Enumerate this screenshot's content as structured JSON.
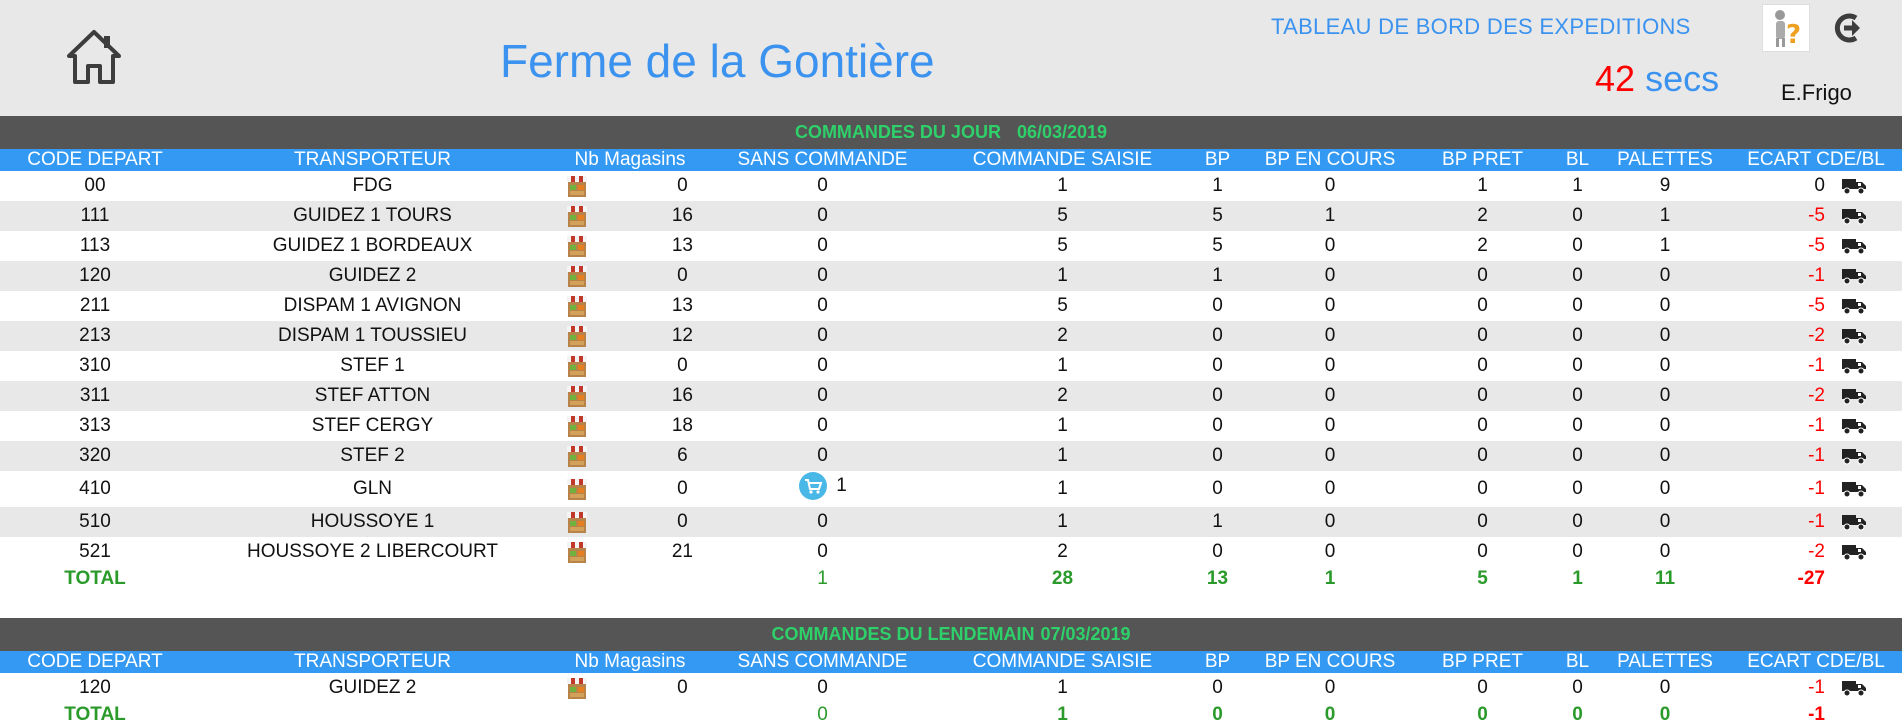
{
  "header": {
    "farm_title": "Ferme de la Gontière",
    "dashboard_title": "TABLEAU DE BORD DES EXPEDITIONS",
    "timer_value": "42",
    "timer_unit": "secs",
    "user": "E.Frigo"
  },
  "columns": [
    "CODE DEPART",
    "TRANSPORTEUR",
    "Nb Magasins",
    "SANS COMMANDE",
    "COMMANDE SAISIE",
    "BP",
    "BP EN COURS",
    "BP PRET",
    "BL",
    "PALETTES",
    "ECART CDE/BL"
  ],
  "section_today": {
    "title": "COMMANDES DU JOUR",
    "date": "06/03/2019",
    "rows": [
      {
        "code": "00",
        "transporteur": "FDG",
        "nb": "0",
        "sans": "0",
        "saisie": "1",
        "bp": "1",
        "encours": "0",
        "pret": "1",
        "bl": "1",
        "palettes": "9",
        "ecart": "0"
      },
      {
        "code": "111",
        "transporteur": "GUIDEZ 1 TOURS",
        "nb": "16",
        "sans": "0",
        "saisie": "5",
        "bp": "5",
        "encours": "1",
        "pret": "2",
        "bl": "0",
        "palettes": "1",
        "ecart": "-5"
      },
      {
        "code": "113",
        "transporteur": "GUIDEZ 1 BORDEAUX",
        "nb": "13",
        "sans": "0",
        "saisie": "5",
        "bp": "5",
        "encours": "0",
        "pret": "2",
        "bl": "0",
        "palettes": "1",
        "ecart": "-5"
      },
      {
        "code": "120",
        "transporteur": "GUIDEZ 2",
        "nb": "0",
        "sans": "0",
        "saisie": "1",
        "bp": "1",
        "encours": "0",
        "pret": "0",
        "bl": "0",
        "palettes": "0",
        "ecart": "-1"
      },
      {
        "code": "211",
        "transporteur": "DISPAM 1 AVIGNON",
        "nb": "13",
        "sans": "0",
        "saisie": "5",
        "bp": "0",
        "encours": "0",
        "pret": "0",
        "bl": "0",
        "palettes": "0",
        "ecart": "-5"
      },
      {
        "code": "213",
        "transporteur": "DISPAM 1 TOUSSIEU",
        "nb": "12",
        "sans": "0",
        "saisie": "2",
        "bp": "0",
        "encours": "0",
        "pret": "0",
        "bl": "0",
        "palettes": "0",
        "ecart": "-2"
      },
      {
        "code": "310",
        "transporteur": "STEF 1",
        "nb": "0",
        "sans": "0",
        "saisie": "1",
        "bp": "0",
        "encours": "0",
        "pret": "0",
        "bl": "0",
        "palettes": "0",
        "ecart": "-1"
      },
      {
        "code": "311",
        "transporteur": "STEF ATTON",
        "nb": "16",
        "sans": "0",
        "saisie": "2",
        "bp": "0",
        "encours": "0",
        "pret": "0",
        "bl": "0",
        "palettes": "0",
        "ecart": "-2"
      },
      {
        "code": "313",
        "transporteur": "STEF CERGY",
        "nb": "18",
        "sans": "0",
        "saisie": "1",
        "bp": "0",
        "encours": "0",
        "pret": "0",
        "bl": "0",
        "palettes": "0",
        "ecart": "-1"
      },
      {
        "code": "320",
        "transporteur": "STEF 2",
        "nb": "6",
        "sans": "0",
        "saisie": "1",
        "bp": "0",
        "encours": "0",
        "pret": "0",
        "bl": "0",
        "palettes": "0",
        "ecart": "-1"
      },
      {
        "code": "410",
        "transporteur": "GLN",
        "nb": "0",
        "sans": "1",
        "saisie": "1",
        "bp": "0",
        "encours": "0",
        "pret": "0",
        "bl": "0",
        "palettes": "0",
        "ecart": "-1"
      },
      {
        "code": "510",
        "transporteur": "HOUSSOYE 1",
        "nb": "0",
        "sans": "0",
        "saisie": "1",
        "bp": "1",
        "encours": "0",
        "pret": "0",
        "bl": "0",
        "palettes": "0",
        "ecart": "-1"
      },
      {
        "code": "521",
        "transporteur": "HOUSSOYE 2 LIBERCOURT",
        "nb": "21",
        "sans": "0",
        "saisie": "2",
        "bp": "0",
        "encours": "0",
        "pret": "0",
        "bl": "0",
        "palettes": "0",
        "ecart": "-2"
      }
    ],
    "total": {
      "label": "TOTAL",
      "sans": "1",
      "saisie": "28",
      "bp": "13",
      "encours": "1",
      "pret": "5",
      "bl": "1",
      "palettes": "11",
      "ecart": "-27"
    }
  },
  "section_tomorrow": {
    "title": "COMMANDES DU LENDEMAIN",
    "date": "07/03/2019",
    "rows": [
      {
        "code": "120",
        "transporteur": "GUIDEZ 2",
        "nb": "0",
        "sans": "0",
        "saisie": "1",
        "bp": "0",
        "encours": "0",
        "pret": "0",
        "bl": "0",
        "palettes": "0",
        "ecart": "-1"
      }
    ],
    "total": {
      "label": "TOTAL",
      "sans": "0",
      "saisie": "1",
      "bp": "0",
      "encours": "0",
      "pret": "0",
      "bl": "0",
      "palettes": "0",
      "ecart": "-1"
    }
  },
  "icons": {
    "home": "home-icon",
    "help": "help-icon",
    "logout": "logout-icon",
    "store": "store-icon",
    "truck": "truck-icon",
    "cart": "cart-icon"
  },
  "colors": {
    "accent_blue": "#3399f3",
    "section_bg": "#555555",
    "section_text": "#2ed06a",
    "total_green": "#2a9a2a",
    "negative_red": "#ff0000",
    "alt_row": "#e8e8e8"
  }
}
